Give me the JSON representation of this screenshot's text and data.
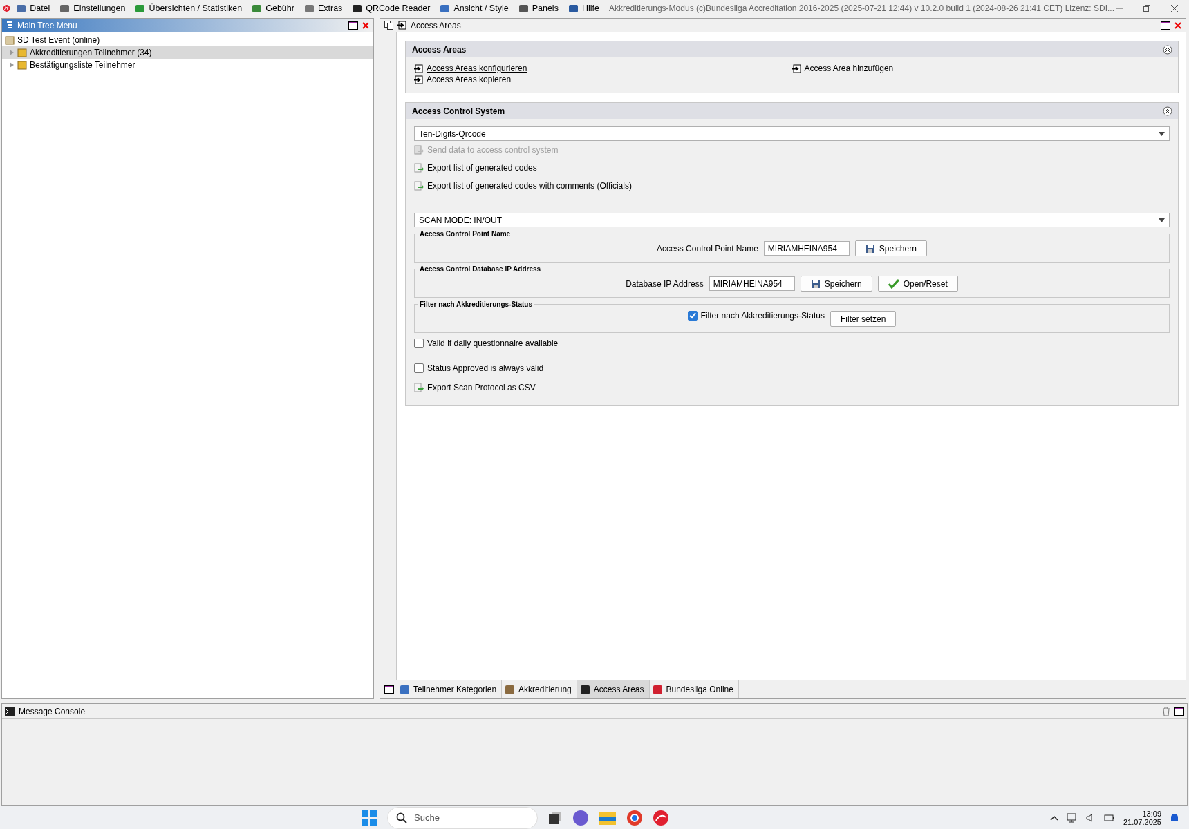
{
  "menu": [
    {
      "label": "Datei"
    },
    {
      "label": "Einstellungen"
    },
    {
      "label": "Übersichten / Statistiken"
    },
    {
      "label": "Gebühr"
    },
    {
      "label": "Extras"
    },
    {
      "label": "QRCode Reader"
    },
    {
      "label": "Ansicht / Style"
    },
    {
      "label": "Panels"
    },
    {
      "label": "Hilfe"
    }
  ],
  "window": {
    "title": "Akkreditierungs-Modus (c)Bundesliga Accreditation 2016-2025 (2025-07-21 12:44) v 10.2.0 build 1 (2024-08-26 21:41 CET) Lizenz: SDI..."
  },
  "tree_panel": {
    "title": "Main Tree Menu",
    "items": [
      {
        "label": "SD Test Event (online)",
        "selected": false,
        "children": [
          {
            "label": "Akkreditierungen Teilnehmer (34)",
            "selected": true,
            "expanded": false
          },
          {
            "label": "Bestätigungsliste Teilnehmer",
            "selected": false,
            "expanded": false
          }
        ]
      }
    ]
  },
  "content_panel": {
    "title": "Access Areas",
    "sections": [
      {
        "title": "Access Areas",
        "expanded": true,
        "link_columns": [
          [
            {
              "label": "Access Areas konfigurieren",
              "underlined": true
            },
            {
              "label": "Access Areas kopieren",
              "underlined": false
            }
          ],
          [
            {
              "label": "Access Area hinzufügen",
              "underlined": false
            }
          ]
        ]
      },
      {
        "title": "Access Control System",
        "expanded": true,
        "items": [
          {
            "kind": "dropdown",
            "value": "Ten-Digits-Qrcode"
          },
          {
            "kind": "action",
            "label": "Send data to access control system",
            "disabled": true
          },
          {
            "kind": "action",
            "label": "Export list of generated codes",
            "disabled": false
          },
          {
            "kind": "action",
            "label": "Export list of generated codes with comments (Officials)",
            "disabled": false
          },
          {
            "kind": "dropdown",
            "value": "SCAN MODE: IN/OUT"
          },
          {
            "kind": "group",
            "title": "Access Control Point Name",
            "controls": [
              {
                "kind": "label",
                "text": "Access Control Point Name"
              },
              {
                "kind": "field",
                "value": "MIRIAMHEINA954"
              },
              {
                "kind": "save",
                "label": "Speichern"
              }
            ]
          },
          {
            "kind": "group",
            "title": "Access Control Database IP Address",
            "controls": [
              {
                "kind": "label",
                "text": "Database IP Address"
              },
              {
                "kind": "field",
                "value": "MIRIAMHEINA954"
              },
              {
                "kind": "save",
                "label": "Speichern"
              },
              {
                "kind": "confirm",
                "label": "Open/Reset"
              }
            ]
          },
          {
            "kind": "group",
            "title": "Filter nach Akkreditierungs-Status",
            "controls": [
              {
                "kind": "checkbox",
                "label": "Filter nach Akkreditierungs-Status",
                "checked": true
              },
              {
                "kind": "plain",
                "label": "Filter setzen"
              }
            ]
          },
          {
            "kind": "checkbox",
            "label": "Valid if daily questionnaire available",
            "checked": false
          },
          {
            "kind": "checkbox",
            "label": "Status Approved is always valid",
            "checked": false
          },
          {
            "kind": "action",
            "label": "Export Scan Protocol as CSV",
            "disabled": false
          }
        ]
      }
    ],
    "tabs": [
      {
        "label": "Teilnehmer Kategorien",
        "selected": false
      },
      {
        "label": "Akkreditierung",
        "selected": false
      },
      {
        "label": "Access Areas",
        "selected": true
      },
      {
        "label": "Bundesliga Online",
        "selected": false
      }
    ]
  },
  "console": {
    "title": "Message Console"
  },
  "taskbar": {
    "search": {
      "placeholder": "Suche"
    },
    "time": "13:09",
    "date": "21.07.2025"
  }
}
